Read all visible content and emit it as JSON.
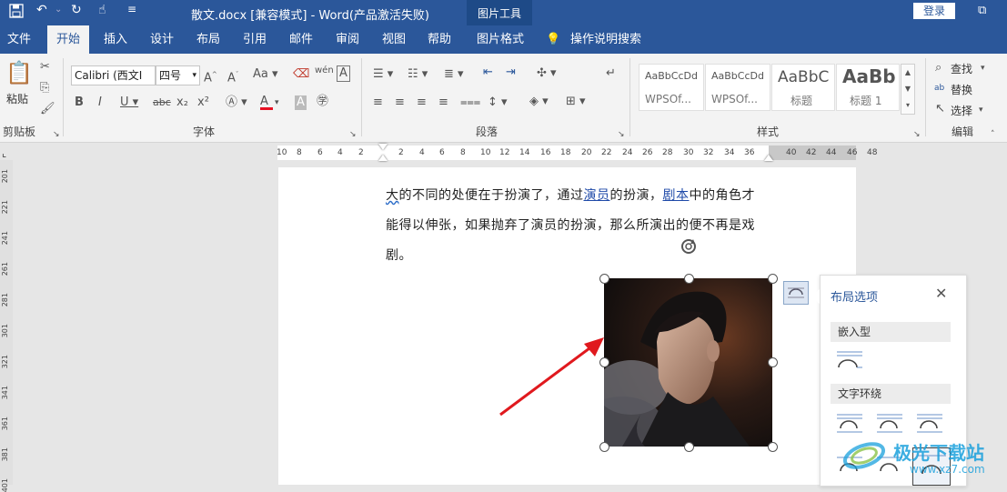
{
  "titlebar": {
    "title": "散文.docx [兼容模式]  -  Word(产品激活失败)",
    "context_tab_group": "图片工具",
    "login": "登录"
  },
  "tabs": [
    "文件",
    "开始",
    "插入",
    "设计",
    "布局",
    "引用",
    "邮件",
    "审阅",
    "视图",
    "帮助",
    "图片格式"
  ],
  "active_tab": "开始",
  "tell_me": "操作说明搜索",
  "ribbon": {
    "clipboard": {
      "paste": "粘贴",
      "label": "剪贴板"
    },
    "font": {
      "name": "Calibri (西文I",
      "size": "四号",
      "label": "字体"
    },
    "paragraph": {
      "label": "段落"
    },
    "styles": {
      "label": "样式",
      "items": [
        {
          "sample": "AaBbCcDd",
          "name": "WPSOf..."
        },
        {
          "sample": "AaBbCcDd",
          "name": "WPSOf..."
        },
        {
          "sample": "AaBbC",
          "name": "标题"
        },
        {
          "sample": "AaBb",
          "name": "标题 1"
        }
      ]
    },
    "editing": {
      "find": "查找",
      "replace": "替换",
      "select": "选择",
      "label": "编辑"
    }
  },
  "ruler": {
    "h_numbers": [
      "10",
      "8",
      "6",
      "4",
      "2",
      "2",
      "4",
      "6",
      "8",
      "10",
      "12",
      "14",
      "16",
      "18",
      "20",
      "22",
      "24",
      "26",
      "28",
      "30",
      "32",
      "34",
      "36",
      "40",
      "42",
      "44",
      "46",
      "48"
    ],
    "v_numbers": [
      "201",
      "221",
      "241",
      "261",
      "281",
      "301",
      "321",
      "341",
      "361",
      "381",
      "401"
    ]
  },
  "document": {
    "line1_parts": [
      "大",
      "的不同的处便在于扮演了，通过",
      "演员",
      "的扮演，",
      "剧本",
      "中的角色才"
    ],
    "line2": "能得以伸张，如果抛弃了演员的扮演，那么所演出的便不再是戏",
    "line3": "剧。"
  },
  "layout_options": {
    "title": "布局选项",
    "inline_label": "嵌入型",
    "wrap_label": "文字环绕"
  },
  "watermark": {
    "name": "极光下载站",
    "url": "www.xz7.com"
  },
  "colors": {
    "accent": "#2b579a",
    "font_color": "#e81123",
    "arrow": "#e0191e"
  }
}
